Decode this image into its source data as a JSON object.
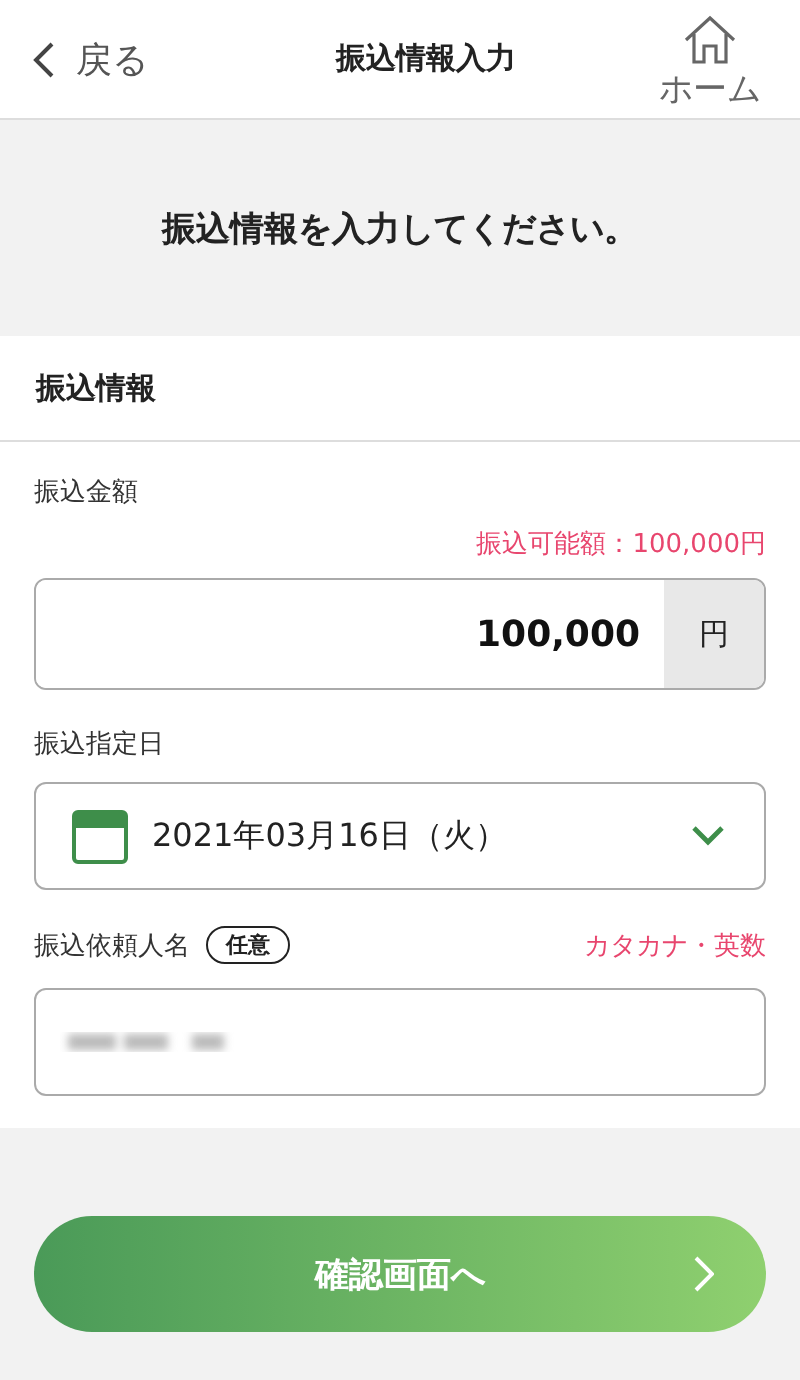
{
  "header": {
    "back": "戻る",
    "title": "振込情報入力",
    "home": "ホーム"
  },
  "message": "振込情報を入力してください。",
  "section": {
    "title": "振込情報"
  },
  "amount": {
    "label": "振込金額",
    "limit": "振込可能額：100,000円",
    "value": "100,000",
    "unit": "円"
  },
  "date": {
    "label": "振込指定日",
    "value": "2021年03月16日（火）"
  },
  "requester": {
    "label": "振込依頼人名",
    "badge": "任意",
    "hint": "カタカナ・英数",
    "value_blurred": true
  },
  "confirm_button": {
    "label": "確認画面へ"
  }
}
